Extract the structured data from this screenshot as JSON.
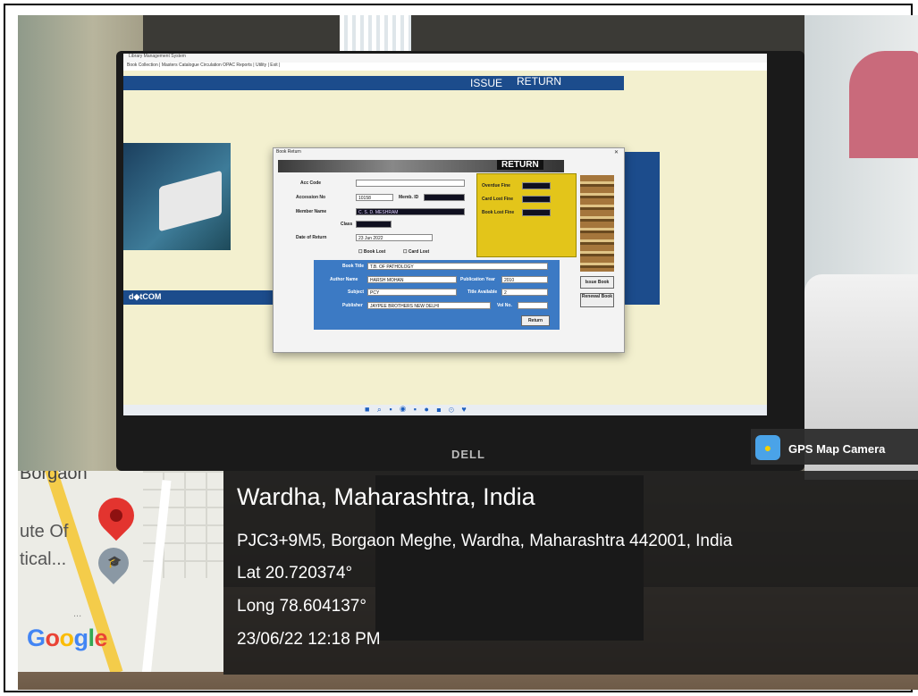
{
  "app": {
    "title": "Library Management System",
    "menu": "Book Collection | Masters   Catalogue   Circulation   OPAC   Reports  |  Utility  |  Exit  |",
    "tabs": [
      "ISSUE",
      "RETURN"
    ],
    "sidebar_label": "d◆tCOM",
    "taskbar_icons": "■ ⌕ ▪ ◉ ▪ ● ◼ ⊙ ♥"
  },
  "dialog": {
    "title": "Book Return",
    "heading": "RETURN",
    "fields": {
      "acc_code_label": "Acc Code",
      "accession_label": "Accession No",
      "accession_value": "10158",
      "memb_id_label": "Memb. ID",
      "member_name_label": "Member Name",
      "member_name_value": "C. S. D. MESHRAM",
      "class_label": "Class",
      "date_return_label": "Date of Return",
      "date_return_value": "23  Jun  2022",
      "book_lost_label": "Book Lost",
      "card_lost_label": "Card Lost"
    },
    "fines": {
      "overdue_label": "Overdue Fine",
      "card_lost_label": "Card Lost Fine",
      "book_lost_label": "Book Lost Fine"
    },
    "book": {
      "title_label": "Book Title",
      "title_value": "T.B. OF PATHOLOGY",
      "author_label": "Author Name",
      "author_value": "HARSH MOHAN",
      "pub_year_label": "Publication Year",
      "pub_year_value": "2010",
      "subject_label": "Subject",
      "subject_value": "PCY",
      "title_avail_label": "Title Available",
      "title_avail_value": "2",
      "publisher_label": "Publisher",
      "publisher_value": "JAYPEE BROTHERS NEW DELHI",
      "vol_label": "Vol No."
    },
    "buttons": {
      "return": "Return",
      "issue_book": "Issue Book",
      "renewal_book": "Renewal Book"
    }
  },
  "monitor_brand": "DELL",
  "gps": {
    "app_label": "GPS Map Camera",
    "city": "Wardha, Maharashtra, India",
    "address": "PJC3+9M5, Borgaon Meghe, Wardha, Maharashtra 442001, India",
    "lat": "Lat 20.720374°",
    "long": "Long 78.604137°",
    "datetime": "23/06/22 12:18 PM"
  },
  "map": {
    "place": "Borgaon",
    "institute_line1": "ute Of",
    "institute_line2": "tical...",
    "dots": "...",
    "logo": "Google"
  },
  "colors": {
    "app_blue": "#1c4c8c",
    "fine_panel_yellow": "#e3c51a",
    "pin_red": "#e3342f"
  }
}
